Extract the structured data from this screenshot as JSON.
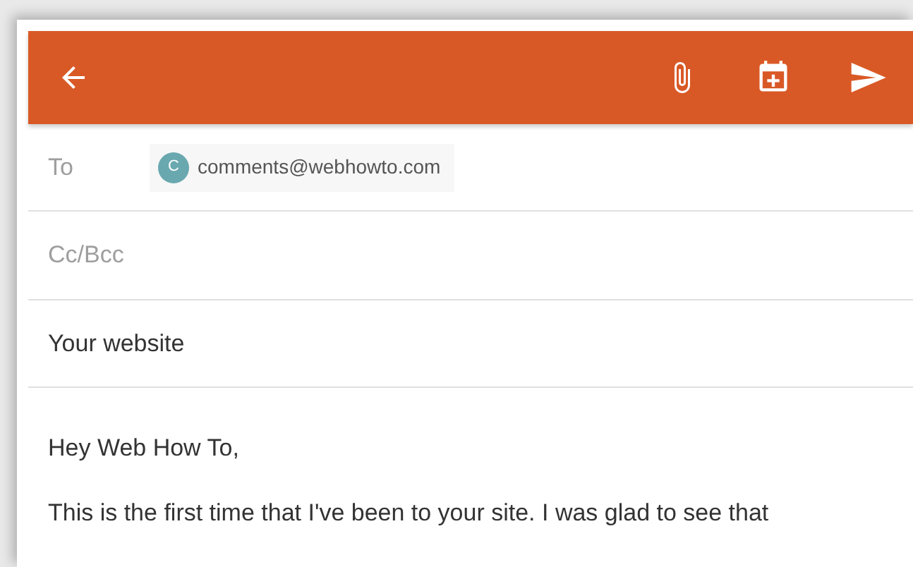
{
  "to": {
    "label": "To",
    "chip": {
      "initial": "C",
      "email": "comments@webhowto.com"
    }
  },
  "cc": {
    "placeholder": "Cc/Bcc"
  },
  "subject": {
    "value": "Your website"
  },
  "body": [
    "Hey Web How To,",
    "This is the first time that I've been to your site. I was glad to see that"
  ]
}
